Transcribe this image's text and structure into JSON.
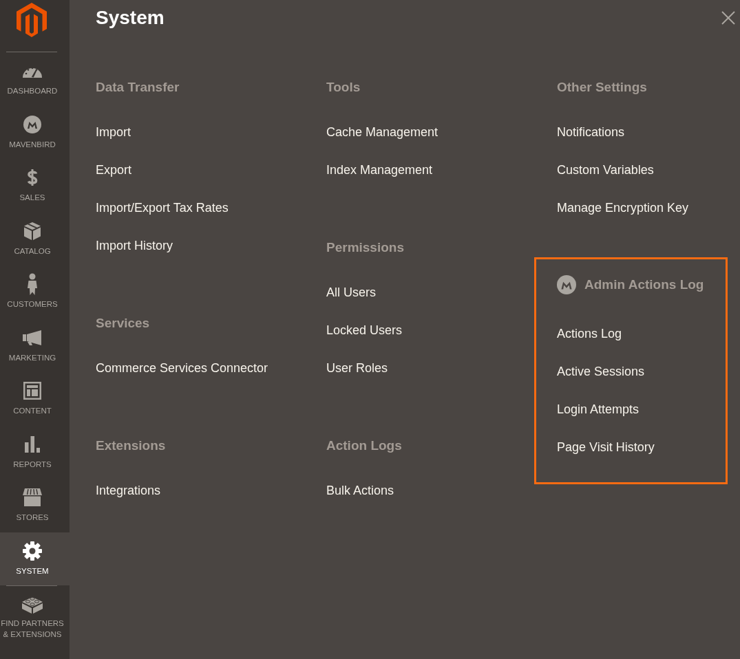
{
  "sidebar": {
    "items": [
      {
        "label": "DASHBOARD",
        "selected": false
      },
      {
        "label": "MAVENBIRD",
        "selected": false
      },
      {
        "label": "SALES",
        "selected": false
      },
      {
        "label": "CATALOG",
        "selected": false
      },
      {
        "label": "CUSTOMERS",
        "selected": false
      },
      {
        "label": "MARKETING",
        "selected": false
      },
      {
        "label": "CONTENT",
        "selected": false
      },
      {
        "label": "REPORTS",
        "selected": false
      },
      {
        "label": "STORES",
        "selected": false
      },
      {
        "label": "SYSTEM",
        "selected": true
      },
      {
        "label": "FIND PARTNERS & EXTENSIONS",
        "selected": false
      }
    ]
  },
  "panel": {
    "title": "System",
    "columns": [
      {
        "sections": [
          {
            "heading": "Data Transfer",
            "kind": "standard",
            "highlighted": false,
            "items": [
              "Import",
              "Export",
              "Import/Export Tax Rates",
              "Import History"
            ]
          },
          {
            "heading": "Services",
            "kind": "standard",
            "highlighted": false,
            "items": [
              "Commerce Services Connector"
            ]
          },
          {
            "heading": "Extensions",
            "kind": "standard",
            "highlighted": false,
            "items": [
              "Integrations"
            ]
          }
        ]
      },
      {
        "sections": [
          {
            "heading": "Tools",
            "kind": "standard",
            "highlighted": false,
            "items": [
              "Cache Management",
              "Index Management"
            ]
          },
          {
            "heading": "Permissions",
            "kind": "standard",
            "highlighted": false,
            "items": [
              "All Users",
              "Locked Users",
              "User Roles"
            ]
          },
          {
            "heading": "Action Logs",
            "kind": "standard",
            "highlighted": false,
            "items": [
              "Bulk Actions"
            ]
          }
        ]
      },
      {
        "sections": [
          {
            "heading": "Other Settings",
            "kind": "standard",
            "highlighted": false,
            "items": [
              "Notifications",
              "Custom Variables",
              "Manage Encryption Key"
            ]
          },
          {
            "heading": "Admin Actions Log",
            "kind": "extension",
            "highlighted": true,
            "items": [
              "Actions Log",
              "Active Sessions",
              "Login Attempts",
              "Page Visit History"
            ]
          }
        ]
      }
    ]
  }
}
